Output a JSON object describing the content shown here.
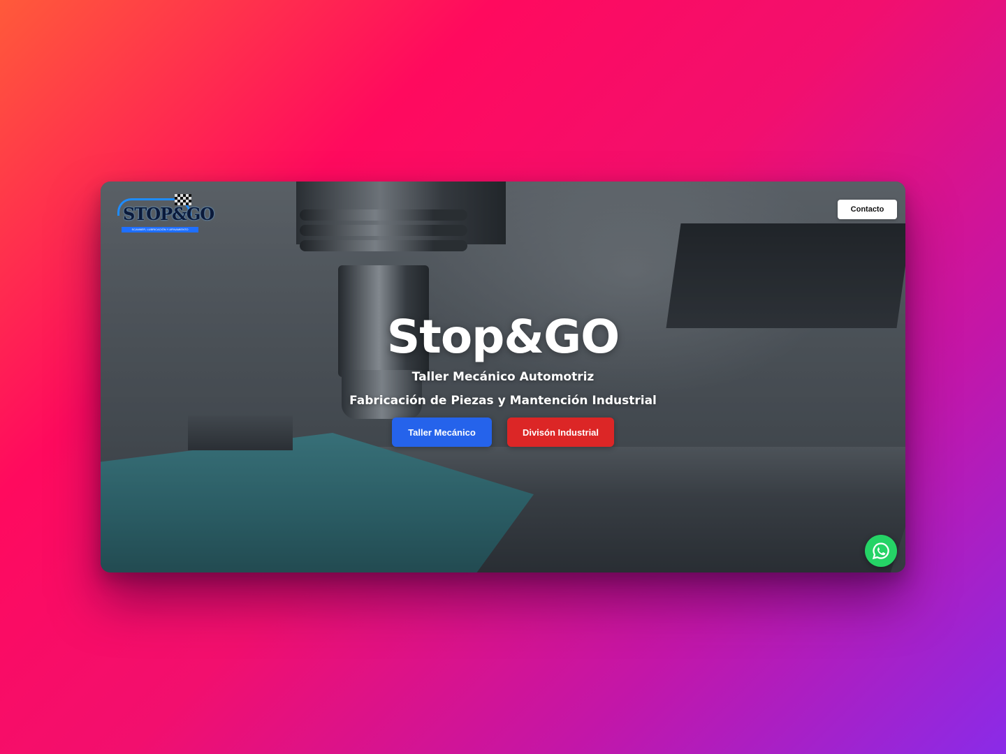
{
  "header": {
    "logo_text": "STOP&GO",
    "logo_tagline": "SCANNER, LUBRICACIÓN Y AFINAMIENTO",
    "contact_label": "Contacto"
  },
  "hero": {
    "title": "Stop&GO",
    "subtitle": "Taller Mecánico Automotriz",
    "subtitle2": "Fabricación de Piezas y Mantención Industrial",
    "buttons": [
      {
        "label": "Taller Mecánico",
        "color": "#2563eb"
      },
      {
        "label": "Divisón Industrial",
        "color": "#dc2626"
      }
    ]
  },
  "floating": {
    "whatsapp_icon": "whatsapp-icon",
    "color": "#25d366"
  },
  "colors": {
    "background_gradient": [
      "#ff5a3a",
      "#ff0a5e",
      "#c316a8",
      "#8a2be8"
    ]
  }
}
